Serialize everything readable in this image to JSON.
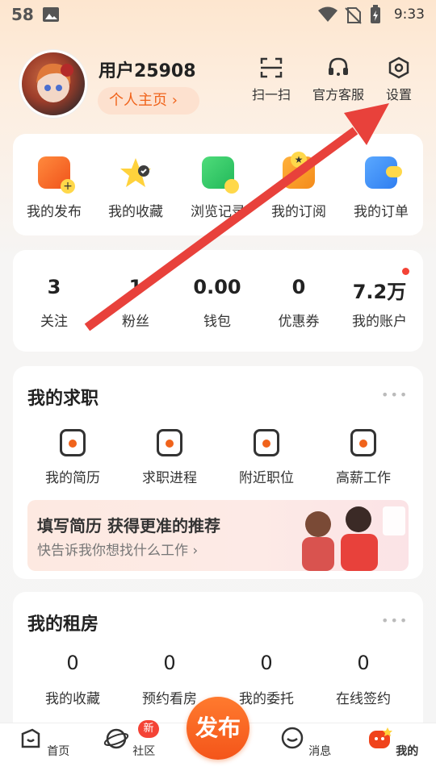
{
  "statusbar": {
    "left": "58",
    "time": "9:33"
  },
  "header": {
    "username": "用户25908",
    "profile_label": "个人主页 ›",
    "actions": [
      {
        "label": "扫一扫",
        "icon": "scan-icon"
      },
      {
        "label": "官方客服",
        "icon": "headset-icon"
      },
      {
        "label": "设置",
        "icon": "settings-icon"
      }
    ]
  },
  "quick": [
    {
      "label": "我的发布",
      "icon": "publish-icon"
    },
    {
      "label": "我的收藏",
      "icon": "star-icon"
    },
    {
      "label": "浏览记录",
      "icon": "history-icon"
    },
    {
      "label": "我的订阅",
      "icon": "subscribe-icon"
    },
    {
      "label": "我的订单",
      "icon": "order-icon"
    }
  ],
  "stats": [
    {
      "value": "3",
      "label": "关注"
    },
    {
      "value": "1",
      "label": "粉丝"
    },
    {
      "value": "0.00",
      "label": "钱包"
    },
    {
      "value": "0",
      "label": "优惠券"
    },
    {
      "value": "7.2万",
      "label": "我的账户"
    }
  ],
  "jobs": {
    "title": "我的求职",
    "more": "•••",
    "items": [
      {
        "label": "我的简历"
      },
      {
        "label": "求职进程"
      },
      {
        "label": "附近职位"
      },
      {
        "label": "高薪工作"
      }
    ],
    "banner_title": "填写简历 获得更准的推荐",
    "banner_sub": "快告诉我你想找什么工作 ›"
  },
  "rent": {
    "title": "我的租房",
    "more": "•••",
    "items": [
      {
        "value": "0",
        "label": "我的收藏"
      },
      {
        "value": "0",
        "label": "预约看房"
      },
      {
        "value": "0",
        "label": "我的委托"
      },
      {
        "value": "0",
        "label": "在线签约"
      }
    ]
  },
  "tabbar": {
    "publish": "发布",
    "new_badge": "新",
    "tabs": [
      {
        "label": "首页"
      },
      {
        "label": "社区"
      },
      {
        "label": "消息"
      },
      {
        "label": "我的"
      }
    ]
  },
  "colors": {
    "accent": "#f0631b",
    "arrow": "#e8413b"
  }
}
